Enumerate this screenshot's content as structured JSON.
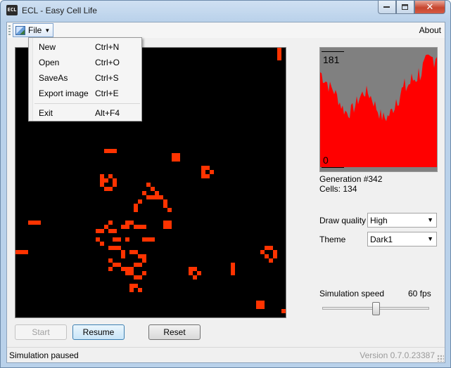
{
  "window": {
    "title": "ECL - Easy Cell Life",
    "icon_text": "ECL"
  },
  "menubar": {
    "file_label": "File",
    "about_label": "About"
  },
  "file_menu": [
    {
      "label": "New",
      "shortcut": "Ctrl+N"
    },
    {
      "label": "Open",
      "shortcut": "Ctrl+O"
    },
    {
      "label": "SaveAs",
      "shortcut": "Ctrl+S"
    },
    {
      "label": "Export image",
      "shortcut": "Ctrl+E"
    },
    {
      "label": "Exit",
      "shortcut": "Alt+F4"
    }
  ],
  "histogram": {
    "max_label": "181",
    "min_label": "0",
    "fill_color": "#ff0000",
    "background_color": "#808080"
  },
  "stats": {
    "generation": "Generation #342",
    "cells": "Cells: 134"
  },
  "settings": {
    "draw_quality_label": "Draw quality",
    "draw_quality_value": "High",
    "theme_label": "Theme",
    "theme_value": "Dark1"
  },
  "speed": {
    "label": "Simulation speed",
    "value": "60 fps"
  },
  "buttons": {
    "start": "Start",
    "resume": "Resume",
    "reset": "Reset"
  },
  "status": {
    "text": "Simulation paused",
    "version": "Version 0.7.0.23387"
  },
  "theme_colors": {
    "board_bg": "#000000",
    "cell": "#ff3300"
  }
}
